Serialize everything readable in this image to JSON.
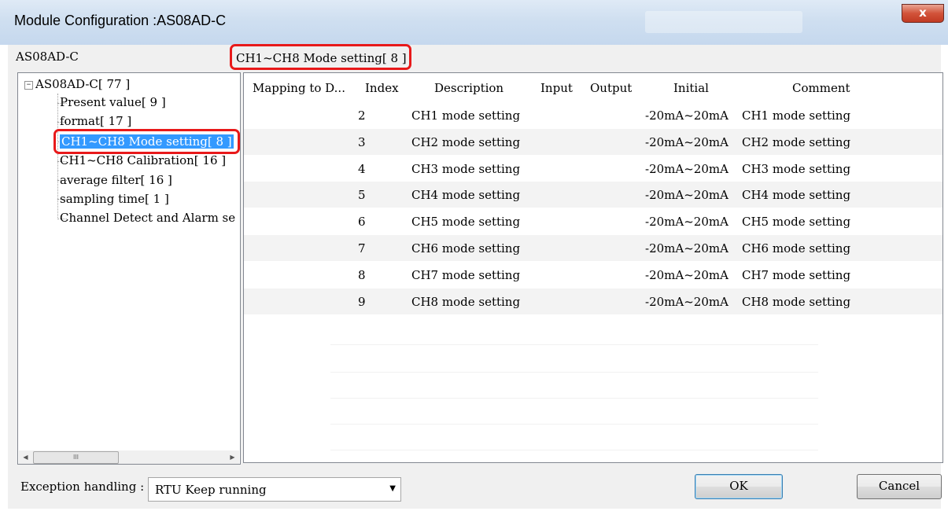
{
  "window": {
    "title": "Module Configuration :AS08AD-C",
    "close_glyph": "x"
  },
  "device_label": "AS08AD-C",
  "node_label": "CH1~CH8 Mode setting[ 8 ]",
  "tree": {
    "root": "AS08AD-C[ 77 ]",
    "items": [
      "Present value[ 9 ]",
      "format[ 17 ]",
      "CH1~CH8 Mode setting[ 8 ]",
      "CH1~CH8 Calibration[ 16 ]",
      "average filter[ 16 ]",
      "sampling time[ 1 ]",
      "Channel Detect and Alarm se"
    ],
    "scroll": {
      "left_arrow": "◀",
      "right_arrow": "▶",
      "grip": "III"
    }
  },
  "grid": {
    "columns": [
      "Mapping to D...",
      "Index",
      "Description",
      "Input",
      "Output",
      "Initial",
      "Comment"
    ],
    "rows": [
      {
        "mapping": "",
        "index": "2",
        "description": "CH1 mode setting",
        "input": "",
        "output": "",
        "initial": "-20mA~20mA",
        "comment": "CH1 mode setting"
      },
      {
        "mapping": "",
        "index": "3",
        "description": "CH2 mode setting",
        "input": "",
        "output": "",
        "initial": "-20mA~20mA",
        "comment": "CH2 mode setting"
      },
      {
        "mapping": "",
        "index": "4",
        "description": "CH3 mode setting",
        "input": "",
        "output": "",
        "initial": "-20mA~20mA",
        "comment": "CH3 mode setting"
      },
      {
        "mapping": "",
        "index": "5",
        "description": "CH4 mode setting",
        "input": "",
        "output": "",
        "initial": "-20mA~20mA",
        "comment": "CH4 mode setting"
      },
      {
        "mapping": "",
        "index": "6",
        "description": "CH5 mode setting",
        "input": "",
        "output": "",
        "initial": "-20mA~20mA",
        "comment": "CH5 mode setting"
      },
      {
        "mapping": "",
        "index": "7",
        "description": "CH6 mode setting",
        "input": "",
        "output": "",
        "initial": "-20mA~20mA",
        "comment": "CH6 mode setting"
      },
      {
        "mapping": "",
        "index": "8",
        "description": "CH7 mode setting",
        "input": "",
        "output": "",
        "initial": "-20mA~20mA",
        "comment": "CH7 mode setting"
      },
      {
        "mapping": "",
        "index": "9",
        "description": "CH8 mode setting",
        "input": "",
        "output": "",
        "initial": "-20mA~20mA",
        "comment": "CH8 mode setting"
      }
    ]
  },
  "footer": {
    "exception_label": "Exception handling :",
    "exception_value": "RTU Keep running",
    "dropdown_glyph": "▼",
    "ok_label": "OK",
    "cancel_label": "Cancel"
  },
  "colors": {
    "highlight_box": "#e8191a",
    "selection": "#3399ff",
    "titlebar": "#cfdff0"
  }
}
